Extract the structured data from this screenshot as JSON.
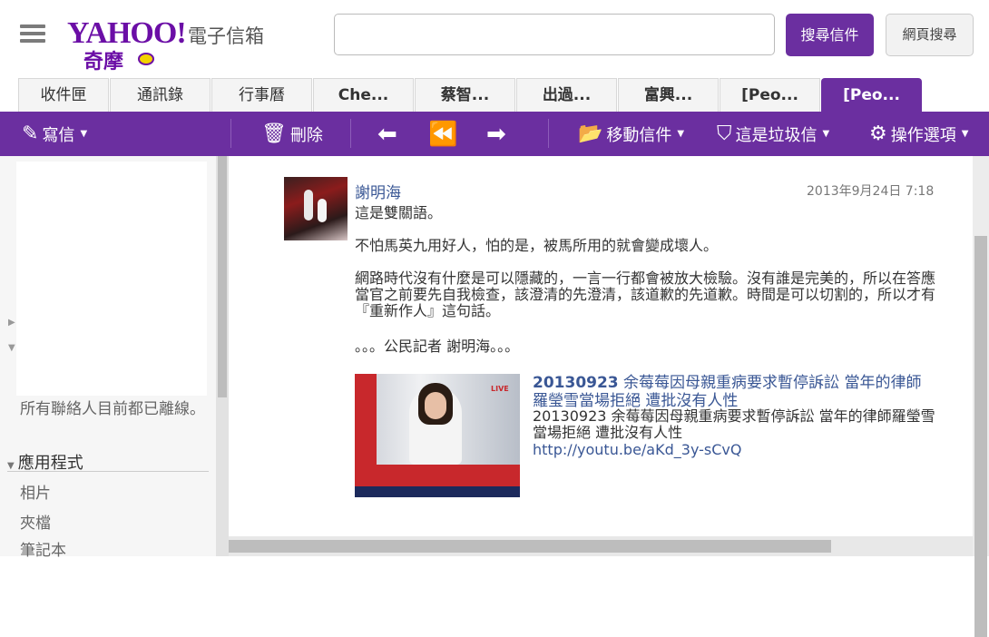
{
  "header": {
    "logo_text": "YAHOO!",
    "logo_sub": "奇摩",
    "brand_title": "電子信箱",
    "search_value": "",
    "search_mail_button": "搜尋信件",
    "search_web_button": "網頁搜尋"
  },
  "tabs": [
    {
      "label": "收件匣"
    },
    {
      "label": "通訊錄"
    },
    {
      "label": "行事曆"
    },
    {
      "label": "Che..."
    },
    {
      "label": "蔡智..."
    },
    {
      "label": "出過..."
    },
    {
      "label": "富興..."
    },
    {
      "label": "[Peo..."
    },
    {
      "label": "[Peo..."
    }
  ],
  "toolbar": {
    "compose": "寫信",
    "delete": "刪除",
    "move": "移動信件",
    "spam": "這是垃圾信",
    "actions": "操作選項"
  },
  "sidebar": {
    "offline_text": "所有聯絡人目前都已離線。",
    "apps_header": "應用程式",
    "apps": [
      {
        "label": "相片"
      },
      {
        "label": "夾檔"
      },
      {
        "label": "筆記本"
      }
    ]
  },
  "message": {
    "sender": "謝明海",
    "date": "2013年9月24日 7:18",
    "line1": "這是雙關語。",
    "line2": "不怕馬英九用好人，怕的是，被馬所用的就會變成壞人。",
    "line3": "網路時代沒有什麼是可以隱藏的，一言一行都會被放大檢驗。沒有誰是完美的，所以在答應當官之前要先自我檢查，該澄清的先澄清，該道歉的先道歉。時間是可以切割的，所以才有『重新作人』這句話。",
    "line4": "。。。公民記者 謝明海。。。",
    "video_title_bold": "20130923",
    "video_title_rest": " 余莓莓因母親重病要求暫停訴訟 當年的律師羅瑩雪當場拒絕 遭批沒有人性",
    "video_desc": "20130923 余莓莓因母親重病要求暫停訴訟 當年的律師羅瑩雪當場拒絕 遭批沒有人性",
    "video_link": "http://youtu.be/aKd_3y-sCvQ"
  },
  "colors": {
    "brand_purple": "#6b2fa0",
    "link_blue": "#3a5795"
  }
}
